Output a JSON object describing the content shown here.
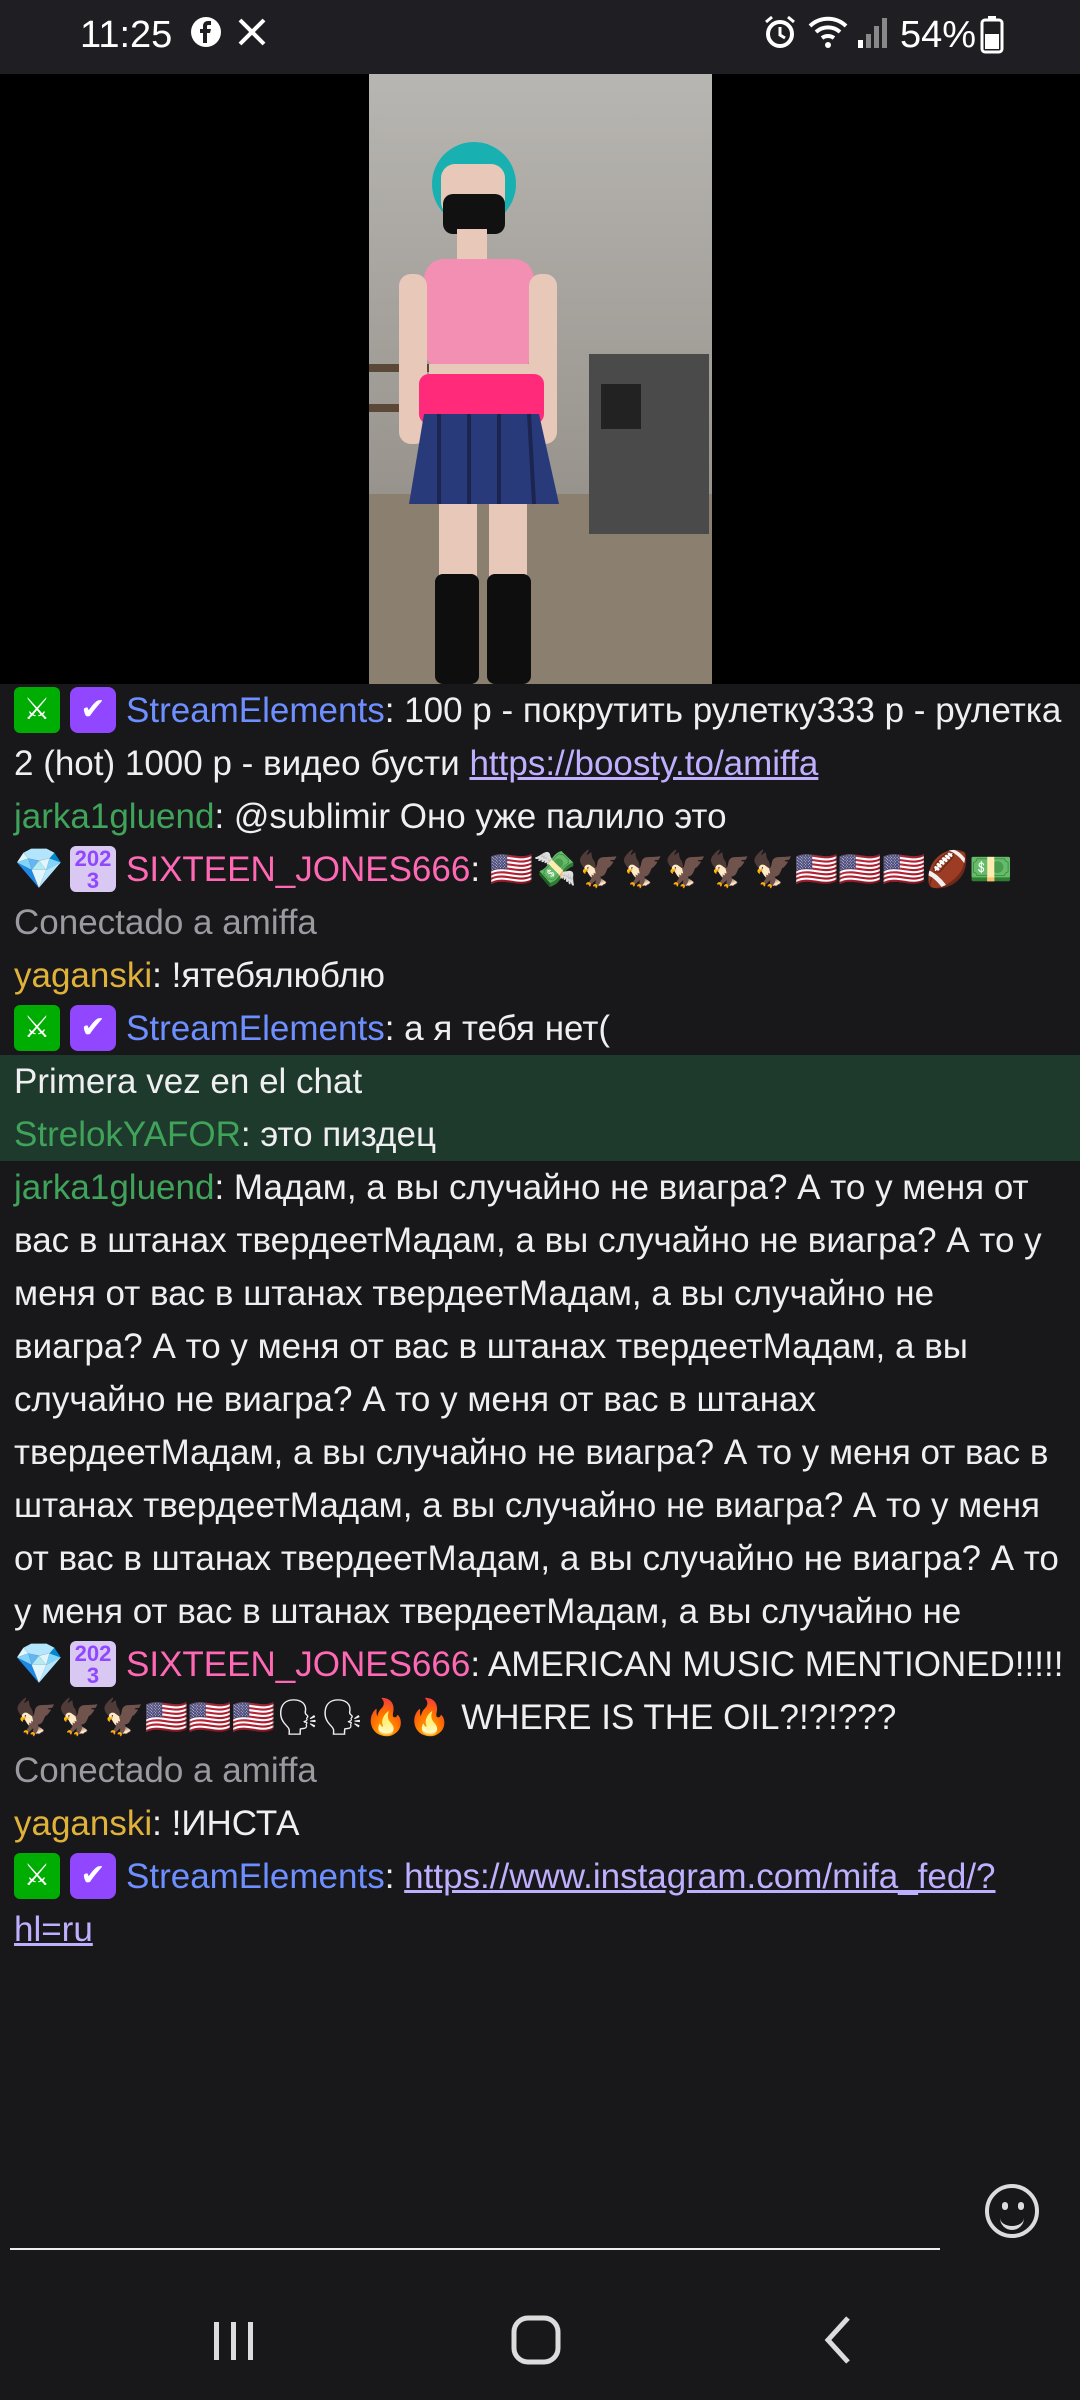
{
  "status_bar": {
    "time": "11:25",
    "battery": "54%"
  },
  "chat": {
    "messages": [
      {
        "type": "user",
        "badges": [
          "mod",
          "verified"
        ],
        "user": "StreamElements",
        "color": "se",
        "text": "100 р - покрутить рулетку333 р - рулетка 2 (hot) 1000 р - видео бусти ",
        "link": "https://boosty.to/amiffa"
      },
      {
        "type": "user",
        "badges": [],
        "user": "jarka1gluend",
        "color": "green",
        "text": "@sublimir Оно уже палило это"
      },
      {
        "type": "user",
        "badges": [
          "diamond",
          "sub23"
        ],
        "user": "SIXTEEN_JONES666",
        "color": "pink",
        "text": "🇺🇸💸🦅🦅🦅🦅🦅🇺🇸🇺🇸🇺🇸🏈💵"
      },
      {
        "type": "system",
        "text": "Conectado a amiffa"
      },
      {
        "type": "user",
        "badges": [],
        "user": "yaganski",
        "color": "yellow",
        "text": "!ятебялюблю"
      },
      {
        "type": "user",
        "badges": [
          "mod",
          "verified"
        ],
        "user": "StreamElements",
        "color": "se",
        "text": "а я тебя нет("
      },
      {
        "type": "first",
        "header": "Primera vez en el chat",
        "user": "StrelokYAFOR",
        "color": "green",
        "text": "это пиздец"
      },
      {
        "type": "user",
        "badges": [],
        "user": "jarka1gluend",
        "color": "green",
        "text": "Мадам, а вы случайно не виагра? А то у меня от вас в штанах твердеетМадам, а вы случайно не виагра? А то у меня от вас в штанах твердеетМадам, а вы случайно не виагра? А то у меня от вас в штанах твердеетМадам, а вы случайно не виагра? А то у меня от вас в штанах твердеетМадам, а вы случайно не виагра? А то у меня от вас в штанах твердеетМадам, а вы случайно не виагра? А то у меня от вас в штанах твердеетМадам, а вы случайно не виагра? А то у меня от вас в штанах твердеетМадам, а вы случайно не"
      },
      {
        "type": "user",
        "badges": [
          "diamond",
          "sub23"
        ],
        "user": "SIXTEEN_JONES666",
        "color": "pink",
        "text": "AMERICAN MUSIC MENTIONED!!!!! 🦅🦅🦅🇺🇸🇺🇸🇺🇸🗣🗣🔥🔥 WHERE IS THE OIL?!?!???"
      },
      {
        "type": "system",
        "text": "Conectado a amiffa"
      },
      {
        "type": "user",
        "badges": [],
        "user": "yaganski",
        "color": "yellow",
        "text": "!ИНСТА"
      },
      {
        "type": "user",
        "badges": [
          "mod",
          "verified"
        ],
        "user": "StreamElements",
        "color": "se",
        "text": "",
        "link": "https://www.instagram.com/mifa_fed/?hl=ru"
      }
    ],
    "badge_text": {
      "sub23": "2023"
    }
  },
  "icons": {
    "status_left": [
      "facebook-icon",
      "x-icon"
    ],
    "status_right": [
      "alarm-icon",
      "wifi-icon",
      "signal-icon",
      "battery-icon"
    ],
    "input": "emoji-icon",
    "nav": [
      "recents-icon",
      "home-icon",
      "back-icon"
    ]
  },
  "colors": {
    "background": "#18181b",
    "highlight": "#1e3a2c",
    "se_user": "#6e8fff",
    "green_user": "#3fa35a",
    "pink_user": "#ff69b4",
    "yellow_user": "#e0b23a",
    "link": "#bfb0ff"
  }
}
